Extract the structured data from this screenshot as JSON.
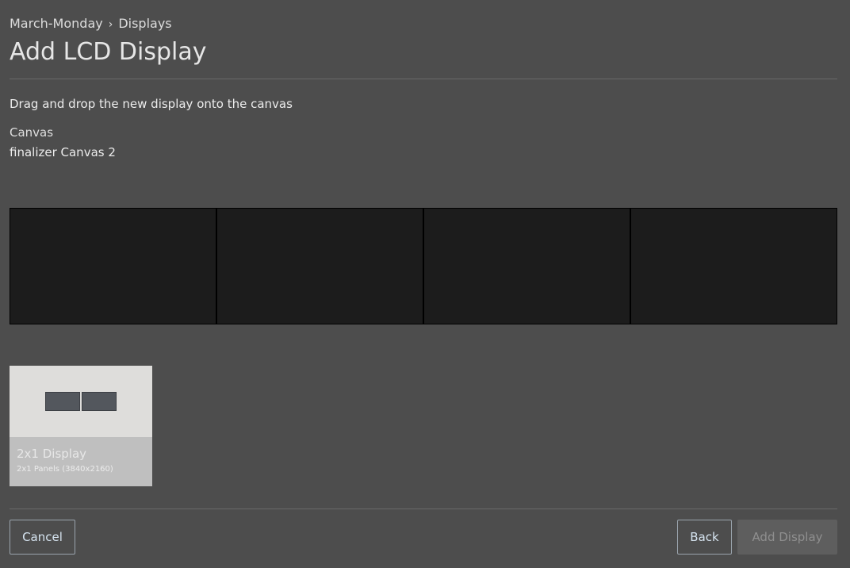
{
  "breadcrumb": {
    "parent": "March-Monday",
    "separator": "›",
    "current": "Displays"
  },
  "page_title": "Add LCD Display",
  "instruction": "Drag and drop the new display onto the canvas",
  "canvas": {
    "label": "Canvas",
    "name": "finalizer Canvas 2",
    "slot_count": 4
  },
  "display_card": {
    "title": "2x1 Display",
    "subtitle": "2x1 Panels (3840x2160)",
    "panel_columns": 2,
    "panel_rows": 1
  },
  "buttons": {
    "cancel": "Cancel",
    "back": "Back",
    "add_display": "Add Display"
  },
  "colors": {
    "background": "#4d4d4d",
    "canvas_slot": "#1c1c1c",
    "panel": "#53575d",
    "card_preview": "#dedddb",
    "card_info": "#bfbfbf"
  }
}
